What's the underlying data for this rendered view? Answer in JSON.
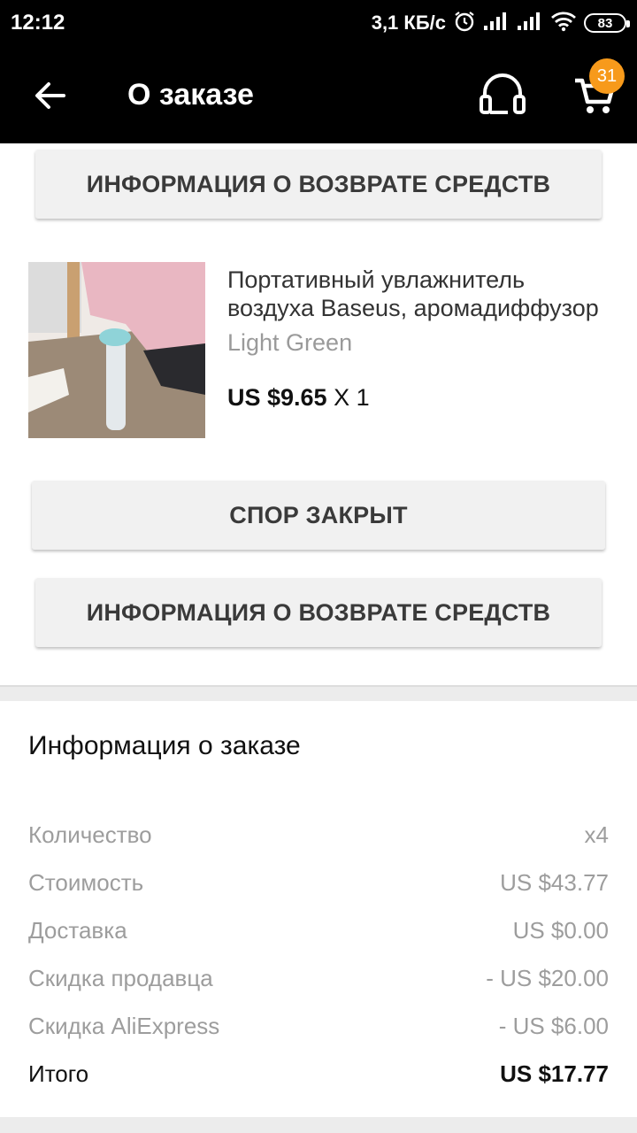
{
  "status_bar": {
    "time": "12:12",
    "net_speed": "3,1 КБ/с",
    "battery": "83"
  },
  "header": {
    "title": "О заказе",
    "cart_count": "31",
    "icons": {
      "back": "back-arrow-icon",
      "support": "headset-icon",
      "cart": "cart-icon"
    }
  },
  "buttons": {
    "refund_info_top": "ИНФОРМАЦИЯ О ВОЗВРАТЕ СРЕДСТВ",
    "dispute": "СПОР ЗАКРЫТ",
    "refund_info_bottom": "ИНФОРМАЦИЯ О ВОЗВРАТЕ СРЕДСТВ"
  },
  "product": {
    "name_line1": "Портативный увлажнитель",
    "name_line2": "воздуха Baseus, аромадиффузор",
    "variant": "Light Green",
    "price": "US $9.65",
    "qty": "X 1"
  },
  "order_info": {
    "title": "Информация о заказе",
    "rows": [
      {
        "label": "Количество",
        "value": "x4"
      },
      {
        "label": "Стоимость",
        "value": "US $43.77"
      },
      {
        "label": "Доставка",
        "value": "US $0.00"
      },
      {
        "label": "Скидка продавца",
        "value": "- US $20.00"
      },
      {
        "label": "Скидка AliExpress",
        "value": "- US $6.00"
      }
    ],
    "total": {
      "label": "Итого",
      "value": "US $17.77"
    }
  },
  "colors": {
    "badge": "#f79a1b",
    "header_bg": "#000000",
    "button_bg": "#f1f1f1"
  }
}
